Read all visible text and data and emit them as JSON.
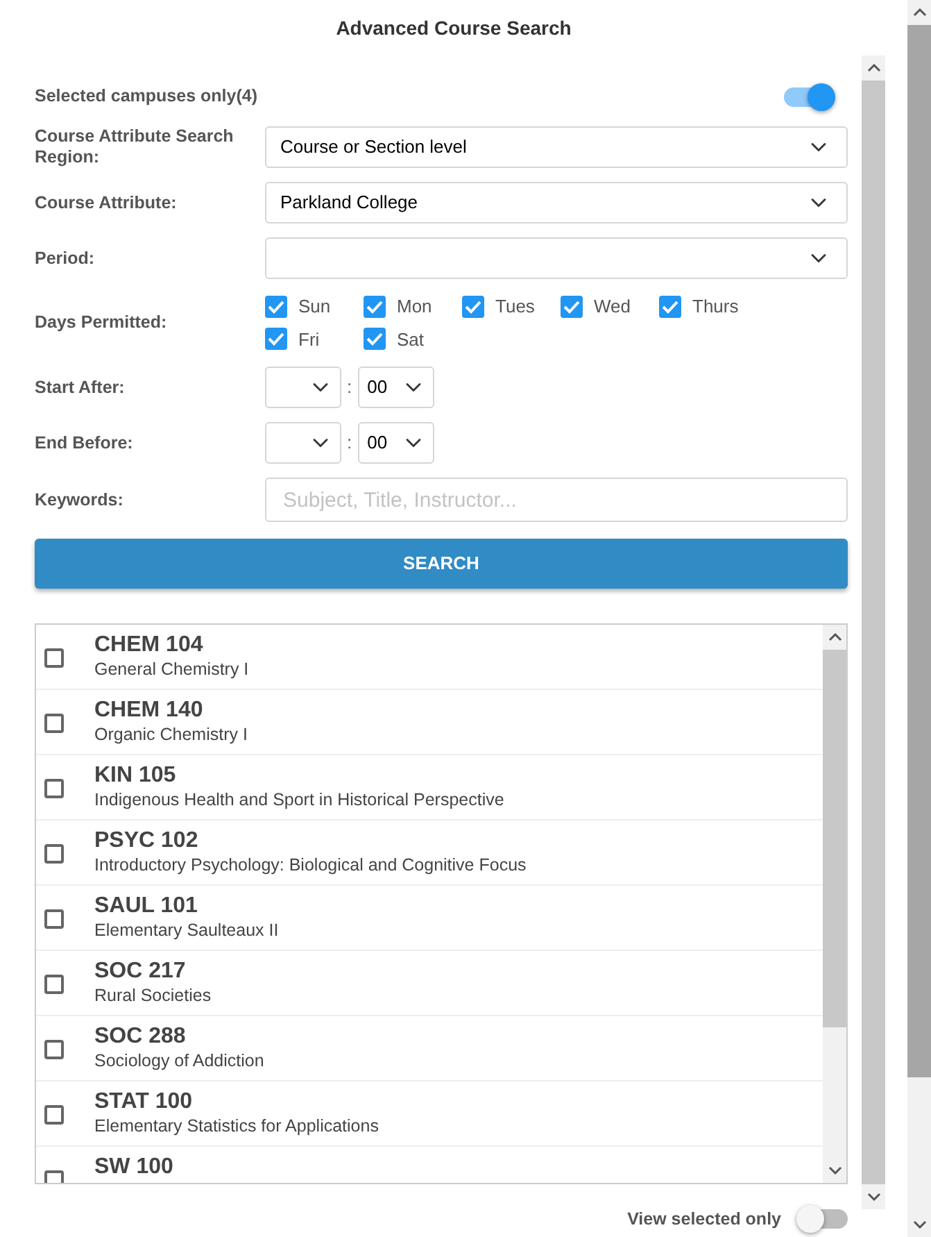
{
  "title": "Advanced Course Search",
  "campus_toggle": {
    "label": "Selected campuses only(4)",
    "on": true
  },
  "fields": [
    {
      "kind": "select",
      "label": "Course Attribute Search Region:",
      "value": "Course or Section level"
    },
    {
      "kind": "select",
      "label": "Course Attribute:",
      "value": "Parkland College"
    },
    {
      "kind": "select",
      "label": "Period:"
    },
    {
      "kind": "days",
      "label": "Days Permitted:",
      "days": [
        {
          "label": "Sun",
          "checked": true
        },
        {
          "label": "Mon",
          "checked": true
        },
        {
          "label": "Tues",
          "checked": true
        },
        {
          "label": "Wed",
          "checked": true
        },
        {
          "label": "Thurs",
          "checked": true
        },
        {
          "label": "Fri",
          "checked": true
        },
        {
          "label": "Sat",
          "checked": true
        }
      ]
    },
    {
      "kind": "time",
      "label": "Start After:",
      "separator": ":",
      "minute": "00"
    },
    {
      "kind": "time",
      "label": "End Before:",
      "separator": ":",
      "minute": "00"
    },
    {
      "kind": "text",
      "label": "Keywords:",
      "placeholder": "Subject, Title, Instructor..."
    }
  ],
  "search_button": "SEARCH",
  "courses": [
    {
      "code": "CHEM 104",
      "title": "General Chemistry I",
      "checked": false
    },
    {
      "code": "CHEM 140",
      "title": "Organic Chemistry I",
      "checked": false
    },
    {
      "code": "KIN 105",
      "title": "Indigenous Health and Sport in Historical Perspective",
      "checked": false
    },
    {
      "code": "PSYC 102",
      "title": "Introductory Psychology: Biological and Cognitive Focus",
      "checked": false
    },
    {
      "code": "SAUL 101",
      "title": "Elementary Saulteaux II",
      "checked": false
    },
    {
      "code": "SOC 217",
      "title": "Rural Societies",
      "checked": false
    },
    {
      "code": "SOC 288",
      "title": "Sociology of Addiction",
      "checked": false
    },
    {
      "code": "STAT 100",
      "title": "Elementary Statistics for Applications",
      "checked": false
    },
    {
      "code": "SW 100",
      "checked": false
    }
  ],
  "view_selected": {
    "label": "View selected only",
    "on": false
  }
}
